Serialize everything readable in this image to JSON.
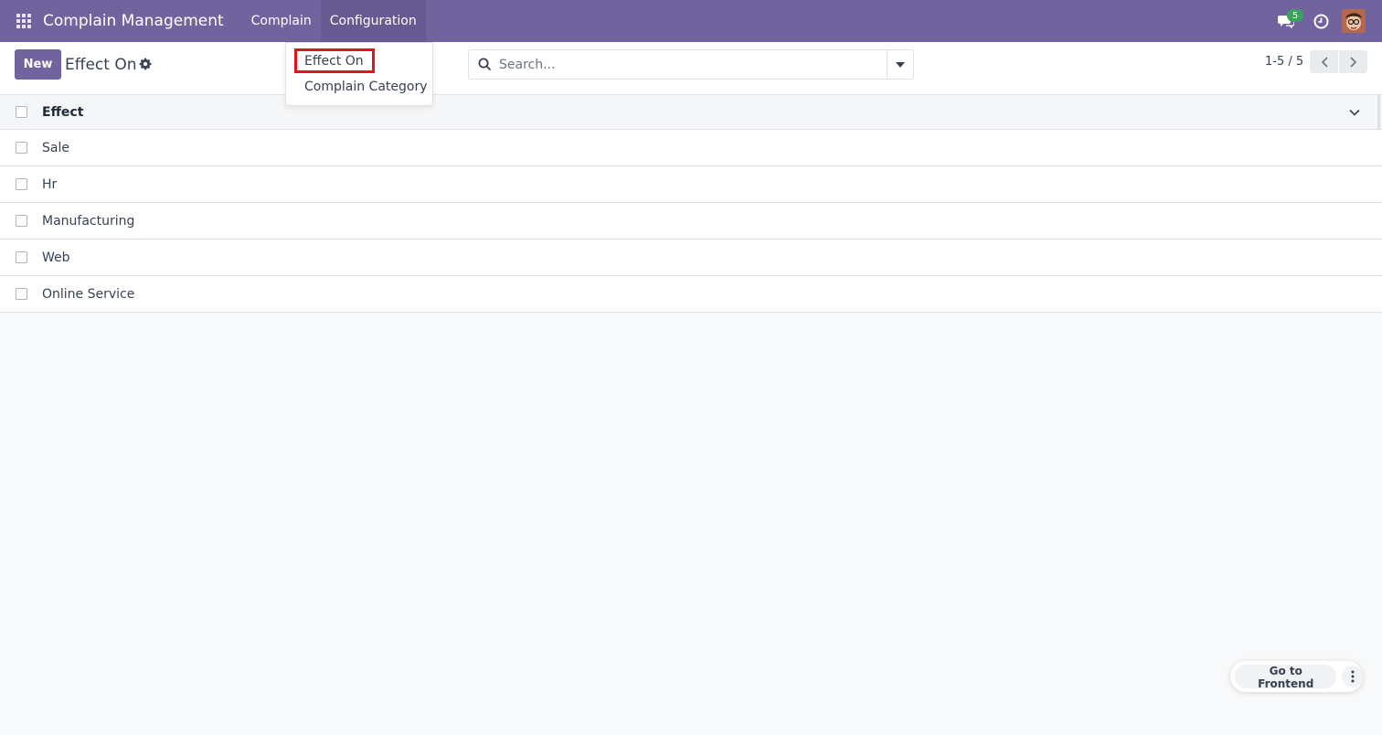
{
  "navbar": {
    "app_title": "Complain Management",
    "menus": [
      {
        "label": "Complain"
      },
      {
        "label": "Configuration"
      }
    ],
    "messages_badge": "5",
    "icons": [
      "apps-grid-icon",
      "chat-icon",
      "clock-icon",
      "avatar"
    ],
    "bg_color": "#71639e"
  },
  "control_panel": {
    "new_label": "New",
    "title": "Effect On",
    "search_placeholder": "Search...",
    "pager": "1-5 / 5"
  },
  "dropdown": {
    "items": [
      {
        "label": "Effect On"
      },
      {
        "label": "Complain Category"
      }
    ]
  },
  "table": {
    "columns": [
      "Effect"
    ],
    "rows": [
      {
        "effect": "Sale"
      },
      {
        "effect": "Hr"
      },
      {
        "effect": "Manufacturing"
      },
      {
        "effect": "Web"
      },
      {
        "effect": "Online Service"
      }
    ]
  },
  "floating": {
    "frontend_label": "Go to Frontend"
  },
  "colors": {
    "accent": "#71639e",
    "highlight": "#e8101c",
    "badge": "#3aa35b"
  }
}
